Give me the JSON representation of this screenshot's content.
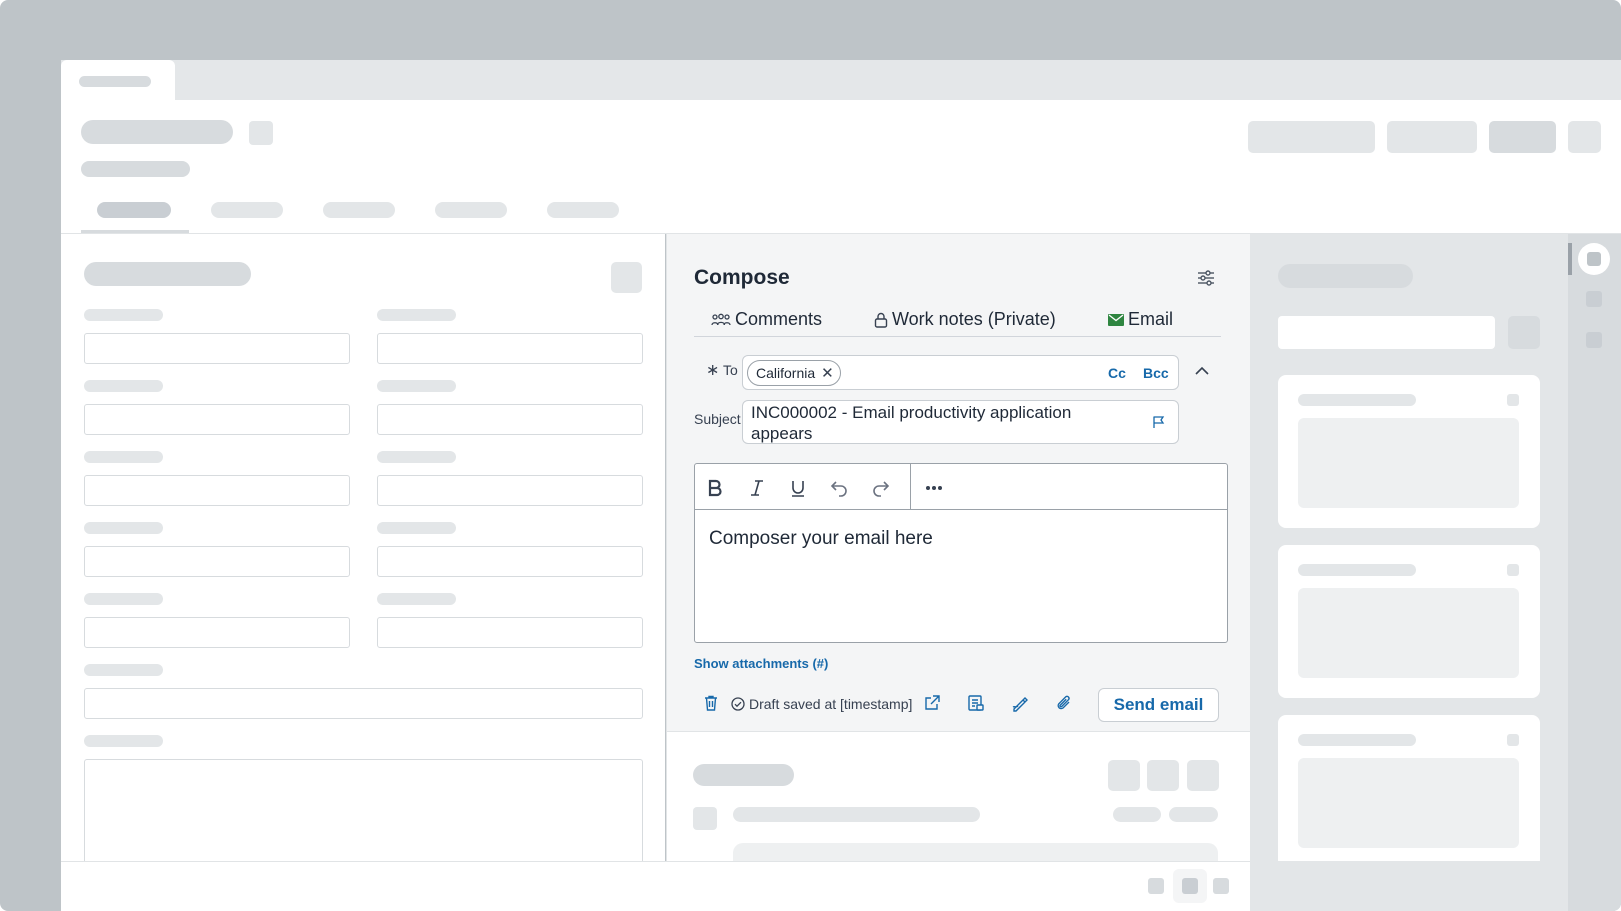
{
  "compose": {
    "title": "Compose",
    "tabs": [
      {
        "label": "Comments",
        "icon": "people-icon"
      },
      {
        "label": "Work notes (Private)",
        "icon": "lock-icon"
      },
      {
        "label": "Email",
        "icon": "envelope-icon"
      }
    ],
    "to": {
      "label": "To",
      "required_mark": "∗",
      "chips": [
        "California"
      ],
      "cc_label": "Cc",
      "bcc_label": "Bcc"
    },
    "subject": {
      "label": "Subject",
      "value": "INC000002 - Email productivity application appears"
    },
    "editor": {
      "body": "Composer your email here"
    },
    "show_attachments": "Show attachments (#)",
    "draft_status": "Draft saved at [timestamp]",
    "send_label": "Send email"
  },
  "colors": {
    "accent": "#1769aa",
    "email_icon": "#2e8540",
    "skeleton": "#d7dbde"
  }
}
